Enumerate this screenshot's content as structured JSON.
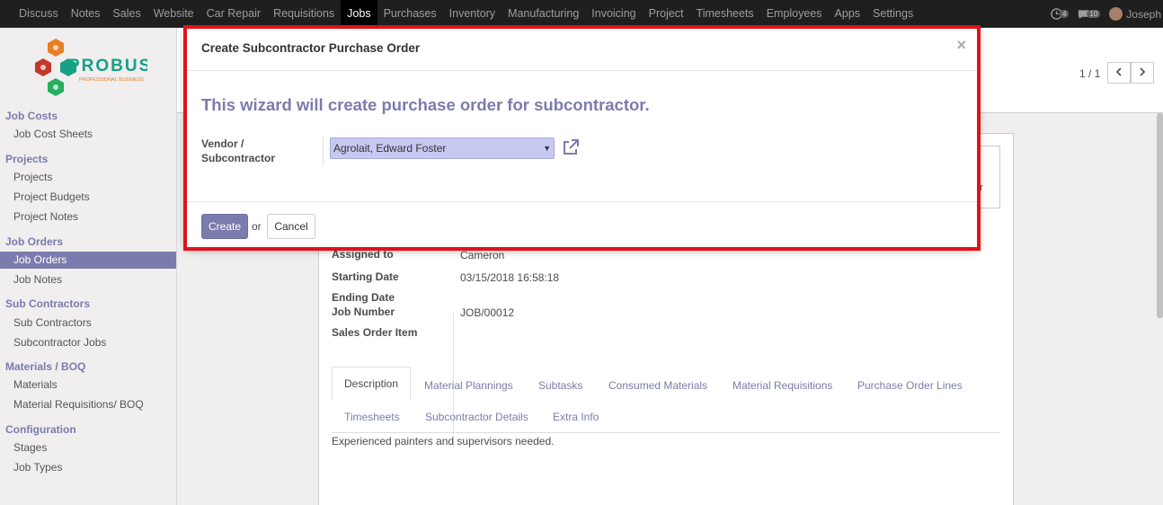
{
  "topnav": {
    "items": [
      "Discuss",
      "Notes",
      "Sales",
      "Website",
      "Car Repair",
      "Requisitions",
      "Jobs",
      "Purchases",
      "Inventory",
      "Manufacturing",
      "Invoicing",
      "Project",
      "Timesheets",
      "Employees",
      "Apps",
      "Settings"
    ],
    "active_index": 6,
    "activity_count": "4",
    "message_count": "10",
    "user": "Joseph"
  },
  "logo": {
    "name": "PROBUSE",
    "tagline": "PROFESSIONAL BUSINESS"
  },
  "sidebar": {
    "sections": [
      {
        "title": "Job Costs",
        "items": [
          "Job Cost Sheets"
        ]
      },
      {
        "title": "Projects",
        "items": [
          "Projects",
          "Project Budgets",
          "Project Notes"
        ]
      },
      {
        "title": "Job Orders",
        "items": [
          "Job Orders",
          "Job Notes"
        ]
      },
      {
        "title": "Sub Contractors",
        "items": [
          "Sub Contractors",
          "Subcontractor Jobs"
        ]
      },
      {
        "title": "Materials / BOQ",
        "items": [
          "Materials",
          "Material Requisitions/ BOQ"
        ]
      },
      {
        "title": "Configuration",
        "items": [
          "Stages",
          "Job Types"
        ]
      }
    ],
    "active_item": "Job Orders"
  },
  "background": {
    "pager": "1 / 1",
    "sidebox_text": "or",
    "fields": {
      "assigned_to_label": "Assigned to",
      "assigned_to_value": "Cameron",
      "starting_date_label": "Starting Date",
      "starting_date_value": "03/15/2018 16:58:18",
      "ending_date_label": "Ending Date",
      "job_number_label": "Job Number",
      "job_number_value": "JOB/00012",
      "sales_order_item_label": "Sales Order Item"
    },
    "tabs": [
      "Description",
      "Material Plannings",
      "Subtasks",
      "Consumed Materials",
      "Material Requisitions",
      "Purchase Order Lines",
      "Timesheets",
      "Subcontractor Details",
      "Extra Info"
    ],
    "description": "Experienced painters and supervisors needed."
  },
  "modal": {
    "title": "Create Subcontractor Purchase Order",
    "close": "×",
    "hero": "This wizard will create purchase order for subcontractor.",
    "vendor_label": "Vendor / Subcontractor",
    "vendor_value": "Agrolait, Edward Foster",
    "create_label": "Create",
    "or_label": "or",
    "cancel_label": "Cancel"
  }
}
